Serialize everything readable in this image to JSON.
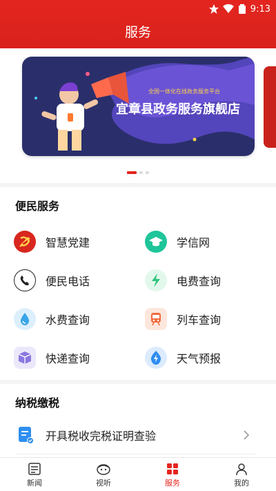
{
  "status": {
    "time": "9:13"
  },
  "header": {
    "title": "服务"
  },
  "banner": {
    "subtitle": "全国一体化在线政务服务平台",
    "title": "宜章县政务服务旗舰店",
    "active_index": 0,
    "count": 3
  },
  "sections": {
    "convenience": {
      "title": "便民服务",
      "items": [
        {
          "label": "智慧党建",
          "icon": "party-emblem-icon",
          "color": "#d8271f"
        },
        {
          "label": "学信网",
          "icon": "graduation-cap-icon",
          "color": "#1fc59a"
        },
        {
          "label": "便民电话",
          "icon": "phone-icon",
          "color": "#222222"
        },
        {
          "label": "电费查询",
          "icon": "lightning-icon",
          "color": "#2fc37d"
        },
        {
          "label": "水费查询",
          "icon": "water-drop-icon",
          "color": "#3aa6e8"
        },
        {
          "label": "列车查询",
          "icon": "train-icon",
          "color": "#f06a3c"
        },
        {
          "label": "快递查询",
          "icon": "package-icon",
          "color": "#8b77e0"
        },
        {
          "label": "天气预报",
          "icon": "weather-bolt-icon",
          "color": "#2d8df0"
        }
      ]
    },
    "tax": {
      "title": "纳税缴税",
      "items": [
        {
          "label": "开具税收完税证明查验",
          "icon": "tax-document-icon",
          "color": "#2f8ff0"
        }
      ]
    }
  },
  "tabbar": {
    "tabs": [
      {
        "label": "新闻",
        "icon": "news-icon"
      },
      {
        "label": "视听",
        "icon": "audio-video-icon"
      },
      {
        "label": "服务",
        "icon": "services-icon",
        "active": true
      },
      {
        "label": "我的",
        "icon": "profile-icon"
      }
    ]
  },
  "colors": {
    "accent": "#e4251f",
    "banner_bg": "#2a2f6b"
  }
}
